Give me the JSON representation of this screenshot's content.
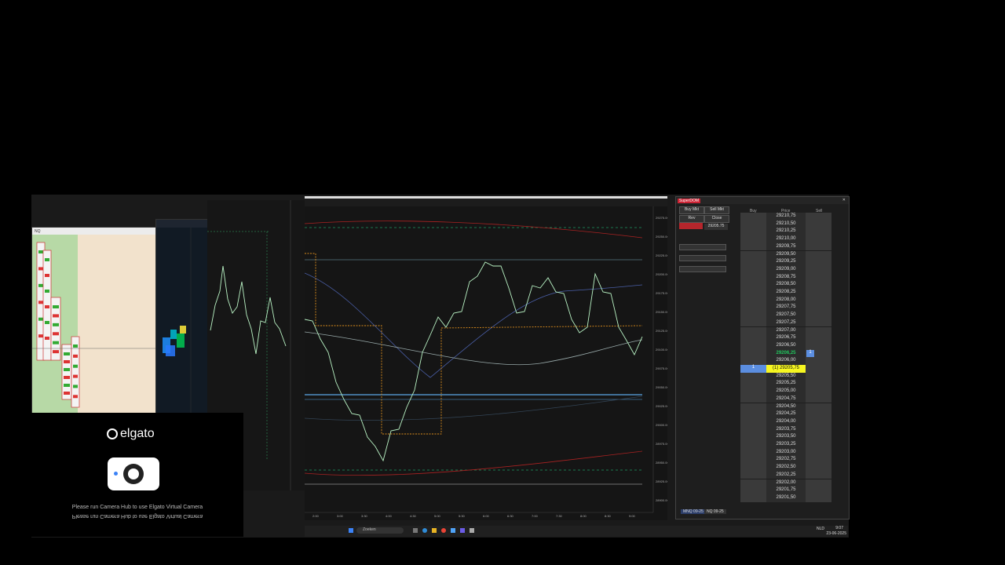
{
  "main_chart": {
    "title": "",
    "price_ticks": [
      "29275.00",
      "29250.00",
      "29225.00",
      "29200.00",
      "29175.00",
      "29150.00",
      "29125.00",
      "29100.00",
      "29075.00",
      "29050.00",
      "29025.00",
      "29000.00",
      "28975.00",
      "28950.00",
      "28925.00",
      "28900.00"
    ],
    "time_ticks": [
      "2:00",
      "3:00",
      "3:30",
      "4:00",
      "4:30",
      "5:00",
      "5:30",
      "6:00",
      "6:30",
      "7:00",
      "7:30",
      "8:00",
      "8:30",
      "9:00"
    ]
  },
  "superdom": {
    "title": "SuperDOM",
    "buy_mkt": "Buy Mkt",
    "sell_mkt": "Sell Mkt",
    "rev": "Rev",
    "close": "Close",
    "price_box": "29205.75",
    "header_buy": "Buy",
    "header_price": "Price",
    "header_sell": "Sell",
    "ladder": [
      "29210,75",
      "29210,50",
      "29210,25",
      "29210,00",
      "29209,75",
      "29209,50",
      "29209,25",
      "29209,00",
      "29208,75",
      "29208,50",
      "29208,25",
      "29208,00",
      "29207,75",
      "29207,50",
      "29207,25",
      "29207,00",
      "29206,75",
      "29206,50",
      "29206,25",
      "29206,00",
      "(1) 29205,75",
      "29205,50",
      "29205,25",
      "29205,00",
      "29204,75",
      "29204,50",
      "29204,25",
      "29204,00",
      "29203,75",
      "29203,50",
      "29203,25",
      "29203,00",
      "29202,75",
      "29202,50",
      "29202,25",
      "29202,00",
      "29201,75",
      "29201,50"
    ],
    "last_index": 18,
    "position_index": 20,
    "sell_qty": "1",
    "buy_qty": "1",
    "tabs": [
      "MNQ 09-25",
      "NQ 09-25"
    ]
  },
  "elgato": {
    "logo": "elgato",
    "message": "Please run Camera Hub to use Elgato Virtual Camera",
    "message_mirror": "Please run Camera Hub to use Elgato Virtual Camera"
  },
  "taskbar": {
    "search": "Zoeken",
    "time": "9:07",
    "date": "23-06-2025",
    "lang": "NLD"
  },
  "colors": {
    "candle": "#b9f3c4",
    "dom_last": "#22c55e",
    "dom_position": "#f7f721",
    "buy_blue": "#5b8ee0"
  }
}
